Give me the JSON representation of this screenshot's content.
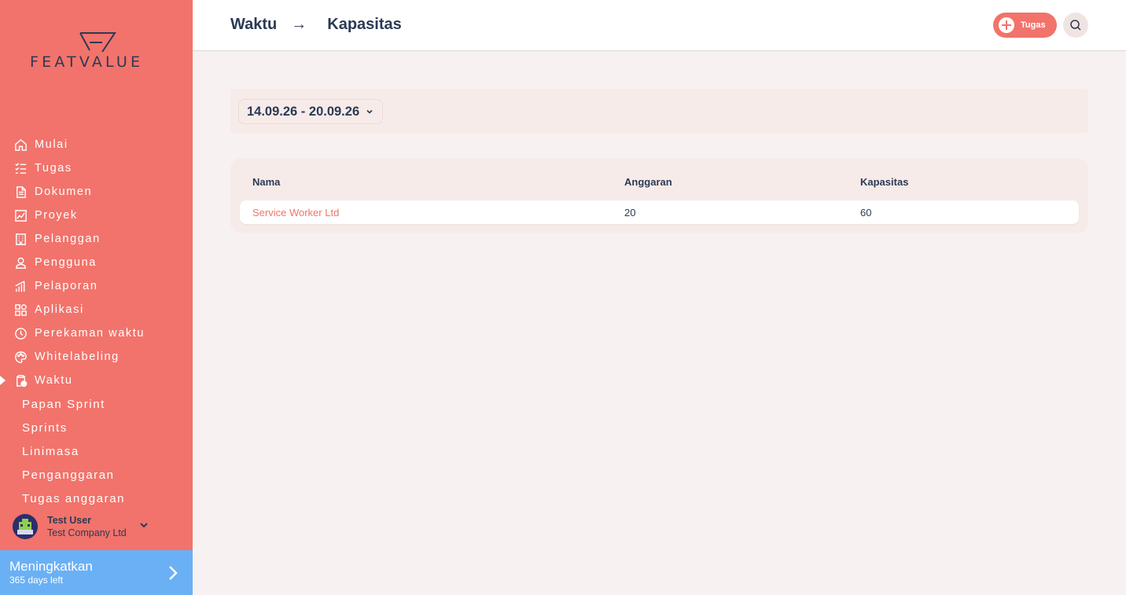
{
  "brand": {
    "name": "FEATVALUE"
  },
  "sidebar": {
    "items": [
      {
        "label": "Mulai",
        "icon": "home-icon"
      },
      {
        "label": "Tugas",
        "icon": "checklist-icon"
      },
      {
        "label": "Dokumen",
        "icon": "document-icon"
      },
      {
        "label": "Proyek",
        "icon": "project-chart-icon"
      },
      {
        "label": "Pelanggan",
        "icon": "building-icon"
      },
      {
        "label": "Pengguna",
        "icon": "user-icon"
      },
      {
        "label": "Pelaporan",
        "icon": "bar-chart-icon"
      },
      {
        "label": "Aplikasi",
        "icon": "apps-icon"
      },
      {
        "label": "Perekaman waktu",
        "icon": "stopwatch-icon"
      },
      {
        "label": "Whitelabeling",
        "icon": "palette-icon"
      },
      {
        "label": "Waktu",
        "icon": "clipboard-clock-icon"
      }
    ],
    "sub_items": [
      "Papan Sprint",
      "Sprints",
      "Linimasa",
      "Penganggaran",
      "Tugas anggaran"
    ],
    "user": {
      "name": "Test User",
      "company": "Test Company Ltd"
    },
    "upgrade": {
      "title": "Meningkatkan",
      "subtitle": "365 days left"
    }
  },
  "header": {
    "breadcrumb": [
      "Waktu",
      "Kapasitas"
    ],
    "breadcrumb_separator": "→",
    "task_button": "Tugas"
  },
  "filter": {
    "date_range": "14.09.26 - 20.09.26"
  },
  "table": {
    "columns": [
      "Nama",
      "Anggaran",
      "Kapasitas"
    ],
    "rows": [
      {
        "name": "Service Worker Ltd",
        "budget": "20",
        "capacity": "60"
      }
    ]
  },
  "colors": {
    "accent": "#f2736b",
    "text": "#2b3a55",
    "upgrade": "#6ab0f5"
  }
}
